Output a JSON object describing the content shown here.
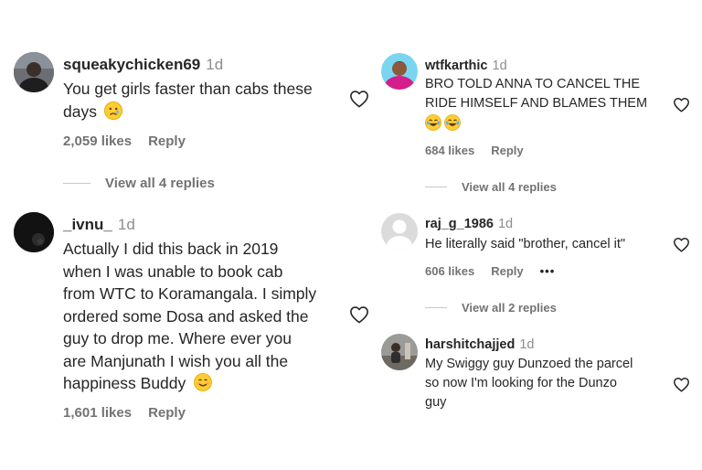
{
  "left": {
    "comments": [
      {
        "username": "squeakychicken69",
        "time": "1d",
        "text": "You get girls faster than cabs these days",
        "text_line1": "You get girls faster than cabs these",
        "text_line2": "days",
        "emoji": "sad-face",
        "likes": "2,059 likes",
        "reply": "Reply",
        "view_replies": "View all 4 replies"
      },
      {
        "username": "_ivnu_",
        "time": "1d",
        "text_line1": "Actually I did this back in 2019",
        "text_line2": "when I was unable to book cab",
        "text_line3": "from WTC to Koramangala. I simply",
        "text_line4": "ordered some Dosa and asked the",
        "text_line5": "guy to drop me. Where ever you",
        "text_line6": "are Manjunath I wish you all the",
        "text_line7": "happiness Buddy",
        "emoji": "smiling-face",
        "likes": "1,601 likes",
        "reply": "Reply"
      }
    ]
  },
  "right": {
    "comments": [
      {
        "username": "wtfkarthic",
        "time": "1d",
        "text_line1": "BRO TOLD ANNA TO CANCEL THE",
        "text_line2": "RIDE HIMSELF AND BLAMES THEM",
        "emoji": "laughing-face",
        "likes": "684 likes",
        "reply": "Reply",
        "view_replies": "View all 4 replies"
      },
      {
        "username": "raj_g_1986",
        "time": "1d",
        "text": "He literally said \"brother, cancel it\"",
        "likes": "606 likes",
        "reply": "Reply",
        "more": "•••",
        "view_replies": "View all 2 replies"
      },
      {
        "username": "harshitchajjed",
        "time": "1d",
        "text_line1": "My Swiggy guy Dunzoed the parcel",
        "text_line2": "so now I'm looking for the Dunzo",
        "text_line3": "guy"
      }
    ]
  },
  "icons": {
    "like": "heart-outline-icon",
    "avatar_placeholder": "default-avatar-icon"
  },
  "colors": {
    "text": "#262626",
    "muted": "#737373",
    "timestamp": "#8e8e8e",
    "divider": "#c7c7c7",
    "emoji": "#ffcc33"
  }
}
